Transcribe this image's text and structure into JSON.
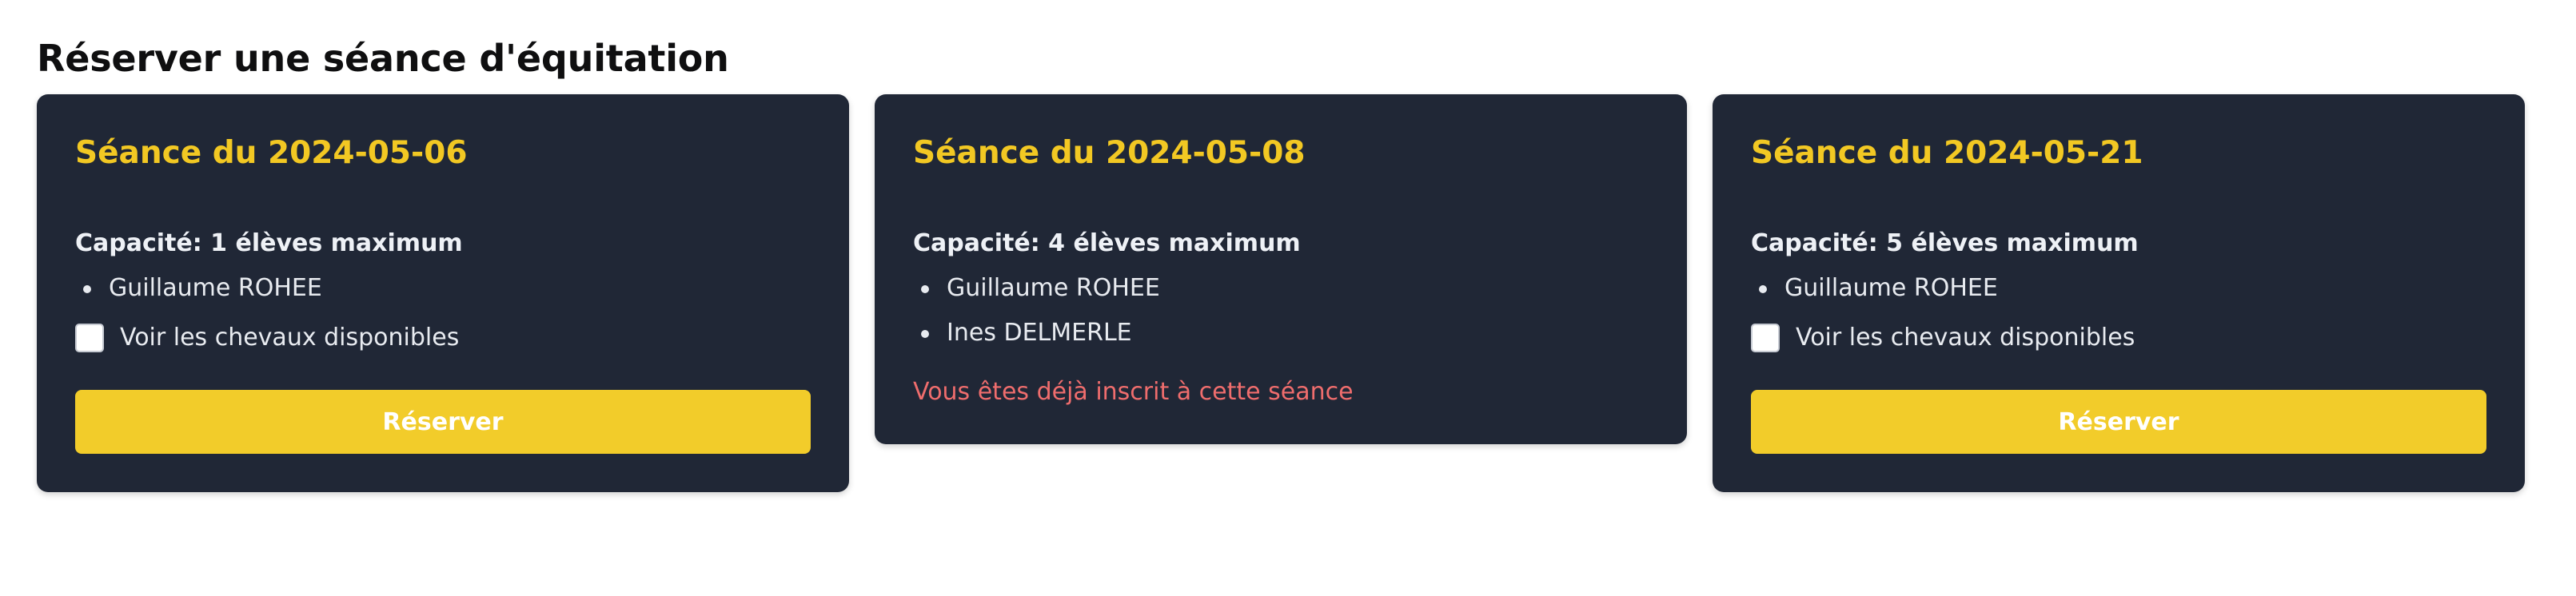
{
  "page": {
    "title": "Réserver une séance d'équitation"
  },
  "cards": [
    {
      "title": "Séance du 2024-05-06",
      "capacity": "Capacité: 1 élèves maximum",
      "students": [
        "Guillaume ROHEE"
      ],
      "checkbox_label": "Voir les chevaux disponibles",
      "button_label": "Réserver"
    },
    {
      "title": "Séance du 2024-05-08",
      "capacity": "Capacité: 4 élèves maximum",
      "students": [
        "Guillaume ROHEE",
        "Ines DELMERLE"
      ],
      "message": "Vous êtes déjà inscrit à cette séance"
    },
    {
      "title": "Séance du 2024-05-21",
      "capacity": "Capacité: 5 élèves maximum",
      "students": [
        "Guillaume ROHEE"
      ],
      "checkbox_label": "Voir les chevaux disponibles",
      "button_label": "Réserver"
    }
  ],
  "colors": {
    "card_bg": "#202736",
    "title_accent": "#f2c823",
    "button_bg": "#f2cc2a",
    "message": "#ef6d6d"
  }
}
